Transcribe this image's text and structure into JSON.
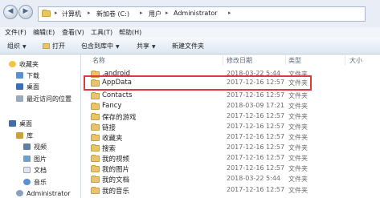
{
  "address": {
    "path": [
      "计算机",
      "新加卷 (C:)",
      "用户",
      "Administrator"
    ]
  },
  "menu": [
    "文件(F)",
    "编辑(E)",
    "查看(V)",
    "工具(T)",
    "帮助(H)"
  ],
  "toolbar": {
    "organize": "组织",
    "open": "打开",
    "include_in_library": "包含到库中",
    "share": "共享",
    "new_folder": "新建文件夹"
  },
  "sidebar": {
    "favorites": "收藏夹",
    "favorites_items": [
      "下载",
      "桌面",
      "最近访问的位置"
    ],
    "desktop": "桌面",
    "library": "库",
    "library_items": [
      "视频",
      "图片",
      "文档",
      "音乐"
    ],
    "admin": "Administrator"
  },
  "columns": {
    "name": "名称",
    "modified": "修改日期",
    "type": "类型",
    "size": "大小"
  },
  "files": [
    {
      "name": ".android",
      "modified": "2018-03-22 5:44",
      "type": "文件夹"
    },
    {
      "name": "AppData",
      "modified": "2017-12-16 12:57",
      "type": "文件夹"
    },
    {
      "name": "Contacts",
      "modified": "2017-12-16 12:57",
      "type": "文件夹"
    },
    {
      "name": "Fancy",
      "modified": "2018-03-09 17:21",
      "type": "文件夹"
    },
    {
      "name": "保存的游戏",
      "modified": "2017-12-16 12:57",
      "type": "文件夹"
    },
    {
      "name": "链接",
      "modified": "2017-12-16 12:57",
      "type": "文件夹"
    },
    {
      "name": "收藏夹",
      "modified": "2017-12-16 12:57",
      "type": "文件夹"
    },
    {
      "name": "搜索",
      "modified": "2017-12-16 12:57",
      "type": "文件夹"
    },
    {
      "name": "我的视频",
      "modified": "2017-12-16 12:57",
      "type": "文件夹"
    },
    {
      "name": "我的图片",
      "modified": "2017-12-16 12:57",
      "type": "文件夹"
    },
    {
      "name": "我的文档",
      "modified": "2018-03-22 5:44",
      "type": "文件夹"
    },
    {
      "name": "我的音乐",
      "modified": "2017-12-16 12:57",
      "type": "文件夹"
    }
  ],
  "colors": {
    "highlight_border": "#e0383b",
    "folder": "#e9c46a"
  }
}
